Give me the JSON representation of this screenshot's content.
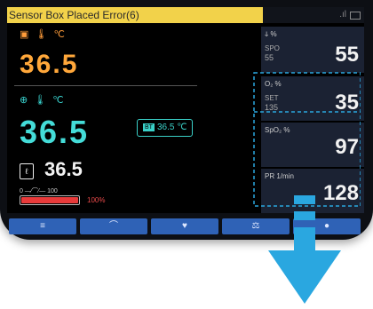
{
  "alarm": {
    "text": "Sensor Box Placed Error(6)",
    "color": "#f2d24a"
  },
  "status": {
    "signal": ".ıl"
  },
  "temp1": {
    "icons": "▣ 🌡 ℃",
    "value": "36.5",
    "color": "#ffa73a"
  },
  "temp2": {
    "icons": "⊕ 🌡 ℃",
    "value": "36.5",
    "color": "#44dcd8",
    "badge_tag": "BT",
    "badge_value": "36.5 ℃"
  },
  "temp3": {
    "icon": "ℓ",
    "value": "36.5"
  },
  "heater": {
    "scale_left": "0",
    "scale_right": "100",
    "percent_label": "100%",
    "level": 1.0,
    "color": "#e83a3a"
  },
  "panels": [
    {
      "label": "ↆ %",
      "sub": "SPO",
      "sub2": "55",
      "value": "55"
    },
    {
      "label": "O₂ %",
      "sub": "SET",
      "sub2": "135",
      "value": "35"
    },
    {
      "label": "SpO₂ %",
      "sub": "",
      "sub2": "",
      "value": "97"
    },
    {
      "label": "PR 1/min",
      "sub": "",
      "sub2": "",
      "value": "128"
    }
  ],
  "navbar": {
    "buttons": [
      {
        "label": "≡",
        "icon": "menu-icon"
      },
      {
        "label": "⌒",
        "icon": "trend-icon"
      },
      {
        "label": "♥",
        "icon": "heart-icon"
      },
      {
        "label": "⚖",
        "icon": "scale-icon"
      },
      {
        "label": "●",
        "icon": "settings-icon"
      }
    ],
    "color": "#2f62b6"
  },
  "colors": {
    "highlight": "#2aa7e0"
  }
}
